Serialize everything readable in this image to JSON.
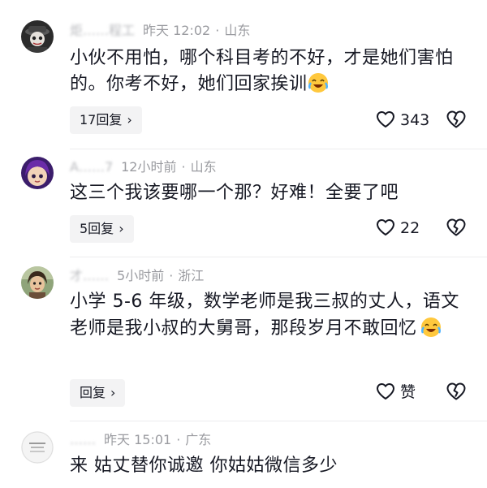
{
  "comments": [
    {
      "username": "炬……程工",
      "time": "昨天 12:02",
      "location": "山东",
      "text": "小伙不用怕，哪个科目考的不好，才是她们害怕的。你考不好，她们回家挨训",
      "emoji": "laughing-crying-emoji",
      "reply_label": "17回复",
      "likes": "343"
    },
    {
      "username": "A……7",
      "time": "12小时前",
      "location": "山东",
      "text": "这三个我该要哪一个那？好难！全要了吧",
      "reply_label": "5回复",
      "likes": "22"
    },
    {
      "username": "才……",
      "time": "5小时前",
      "location": "浙江",
      "text": "小学 5-6 年级，数学老师是我三叔的丈人，语文老师是我小叔的大舅哥，那段岁月不敢回忆",
      "emoji": "laughing-crying-emoji",
      "reply_label": "回复",
      "likes": "赞"
    },
    {
      "username": "……",
      "time": "昨天 15:01",
      "location": "广东",
      "text": "来 姑丈替你诚邀 你姑姑微信多少"
    }
  ],
  "meta_separator": "·",
  "icons": {
    "like": "heart-outline-icon",
    "dislike": "broken-heart-icon",
    "reply_chevron": "chevron-right-icon"
  },
  "colors": {
    "text": "#161823",
    "meta": "#9a9ba0",
    "reply_bg": "#f3f3f4",
    "emoji": "#ffc83d"
  }
}
